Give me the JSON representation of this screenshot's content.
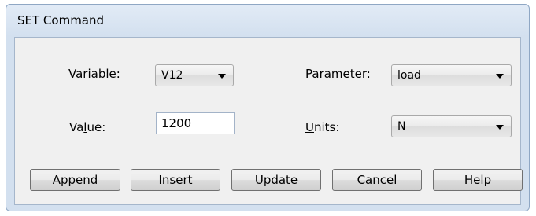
{
  "window": {
    "title": "SET Command"
  },
  "form": {
    "variable": {
      "label_key": "V",
      "label_rest": "ariable:",
      "value": "V12"
    },
    "parameter": {
      "label_key": "P",
      "label_rest": "arameter:",
      "value": "load"
    },
    "value": {
      "label_pre": "Va",
      "label_key": "l",
      "label_rest": "ue:",
      "value": "1200"
    },
    "units": {
      "label_key": "U",
      "label_rest": "nits:",
      "value": "N"
    }
  },
  "buttons": {
    "append": {
      "key": "A",
      "rest": "ppend"
    },
    "insert": {
      "key": "I",
      "rest": "nsert"
    },
    "update": {
      "key": "U",
      "rest": "pdate"
    },
    "cancel": {
      "label": "Cancel"
    },
    "help": {
      "key": "H",
      "rest": "elp"
    }
  },
  "icons": {
    "dropdown": "chevron-down-icon"
  }
}
